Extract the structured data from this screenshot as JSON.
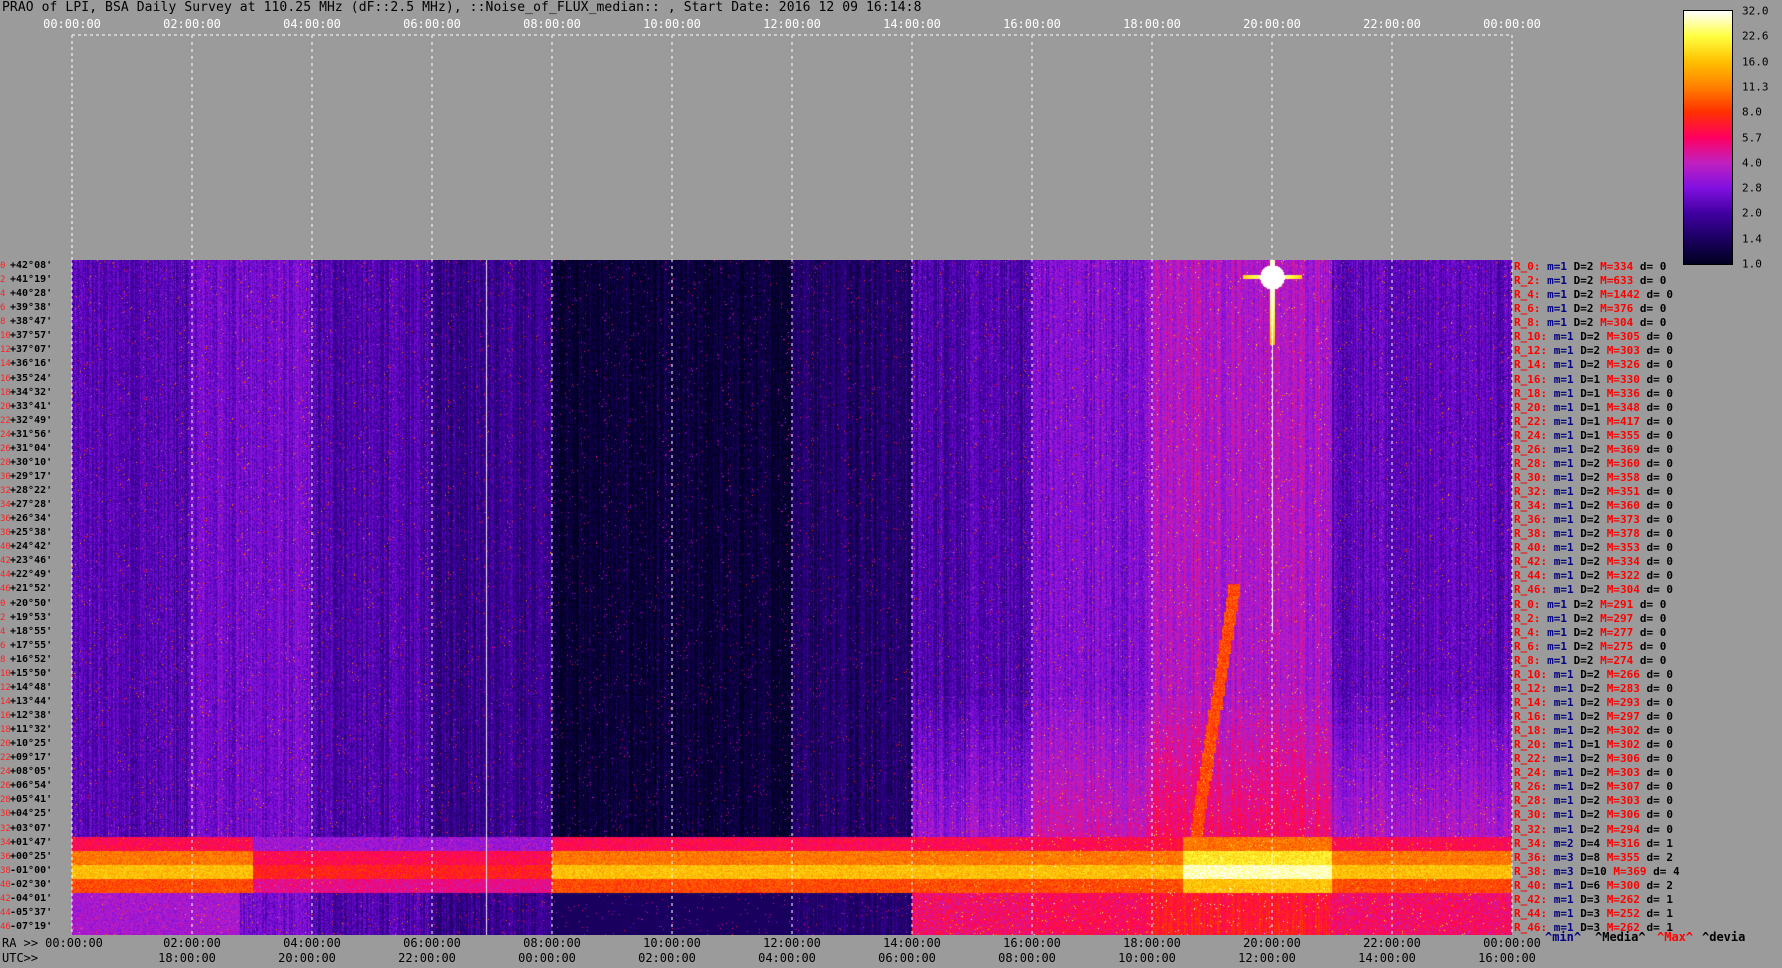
{
  "title": "PRAO of LPI, BSA Daily Survey at 110.25 MHz (dF::2.5 MHz), ::Noise_of_FLUX_median:: , Start Date: 2016 12 09 16:14:8",
  "top_axis_ticks": [
    "00:00:00",
    "02:00:00",
    "04:00:00",
    "06:00:00",
    "08:00:00",
    "10:00:00",
    "12:00:00",
    "14:00:00",
    "16:00:00",
    "18:00:00",
    "20:00:00",
    "22:00:00",
    "00:00:00"
  ],
  "bottom_axis": {
    "ra_label": "RA >>",
    "utc_label": "UTC>>",
    "ra_ticks": [
      "00:00:00",
      "02:00:00",
      "04:00:00",
      "06:00:00",
      "08:00:00",
      "10:00:00",
      "12:00:00",
      "14:00:00",
      "16:00:00",
      "18:00:00",
      "20:00:00",
      "22:00:00",
      "00:00:00"
    ],
    "utc_ticks": [
      "18:00:00",
      "20:00:00",
      "22:00:00",
      "00:00:00",
      "02:00:00",
      "04:00:00",
      "06:00:00",
      "08:00:00",
      "10:00:00",
      "12:00:00",
      "14:00:00",
      "16:00:00"
    ]
  },
  "declinations": [
    "+42°08'",
    "+41°19'",
    "+40°28'",
    "+39°38'",
    "+38°47'",
    "+37°57'",
    "+37°07'",
    "+36°16'",
    "+35°24'",
    "+34°32'",
    "+33°41'",
    "+32°49'",
    "+31°56'",
    "+31°04'",
    "+30°10'",
    "+29°17'",
    "+28°22'",
    "+27°28'",
    "+26°34'",
    "+25°38'",
    "+24°42'",
    "+23°46'",
    "+22°49'",
    "+21°52'",
    "+20°50'",
    "+19°53'",
    "+18°55'",
    "+17°55'",
    "+16°52'",
    "+15°50'",
    "+14°48'",
    "+13°44'",
    "+12°38'",
    "+11°32'",
    "+10°25'",
    "+09°17'",
    "+08°05'",
    "+06°54'",
    "+05°41'",
    "+04°25'",
    "+03°07'",
    "+01°47'",
    "+00°25'",
    "-01°00'",
    "-02°30'",
    "-04°01'",
    "-05°37'",
    "-07°19'"
  ],
  "row_numbers": [
    "0",
    "2",
    "4",
    "6",
    "8",
    "10",
    "12",
    "14",
    "16",
    "18",
    "20",
    "22",
    "24",
    "26",
    "28",
    "30",
    "32",
    "34",
    "36",
    "38",
    "40",
    "42",
    "44",
    "46",
    "0",
    "2",
    "4",
    "6",
    "8",
    "10",
    "12",
    "14",
    "16",
    "18",
    "20",
    "22",
    "24",
    "26",
    "28",
    "30",
    "32",
    "34",
    "36",
    "38",
    "40",
    "42",
    "44",
    "46"
  ],
  "row_stats": [
    {
      "r": "R_0:",
      "m": "m=1",
      "D": "D=2",
      "M": "M=334",
      "d": "d= 0"
    },
    {
      "r": "R_2:",
      "m": "m=1",
      "D": "D=2",
      "M": "M=633",
      "d": "d= 0"
    },
    {
      "r": "R_4:",
      "m": "m=1",
      "D": "D=2",
      "M": "M=1442",
      "d": "d= 0"
    },
    {
      "r": "R_6:",
      "m": "m=1",
      "D": "D=2",
      "M": "M=376",
      "d": "d= 0"
    },
    {
      "r": "R_8:",
      "m": "m=1",
      "D": "D=2",
      "M": "M=304",
      "d": "d= 0"
    },
    {
      "r": "R_10:",
      "m": "m=1",
      "D": "D=2",
      "M": "M=305",
      "d": "d= 0"
    },
    {
      "r": "R_12:",
      "m": "m=1",
      "D": "D=2",
      "M": "M=303",
      "d": "d= 0"
    },
    {
      "r": "R_14:",
      "m": "m=1",
      "D": "D=2",
      "M": "M=326",
      "d": "d= 0"
    },
    {
      "r": "R_16:",
      "m": "m=1",
      "D": "D=1",
      "M": "M=330",
      "d": "d= 0"
    },
    {
      "r": "R_18:",
      "m": "m=1",
      "D": "D=1",
      "M": "M=336",
      "d": "d= 0"
    },
    {
      "r": "R_20:",
      "m": "m=1",
      "D": "D=1",
      "M": "M=348",
      "d": "d= 0"
    },
    {
      "r": "R_22:",
      "m": "m=1",
      "D": "D=1",
      "M": "M=417",
      "d": "d= 0"
    },
    {
      "r": "R_24:",
      "m": "m=1",
      "D": "D=1",
      "M": "M=355",
      "d": "d= 0"
    },
    {
      "r": "R_26:",
      "m": "m=1",
      "D": "D=2",
      "M": "M=369",
      "d": "d= 0"
    },
    {
      "r": "R_28:",
      "m": "m=1",
      "D": "D=2",
      "M": "M=360",
      "d": "d= 0"
    },
    {
      "r": "R_30:",
      "m": "m=1",
      "D": "D=2",
      "M": "M=358",
      "d": "d= 0"
    },
    {
      "r": "R_32:",
      "m": "m=1",
      "D": "D=2",
      "M": "M=351",
      "d": "d= 0"
    },
    {
      "r": "R_34:",
      "m": "m=1",
      "D": "D=2",
      "M": "M=360",
      "d": "d= 0"
    },
    {
      "r": "R_36:",
      "m": "m=1",
      "D": "D=2",
      "M": "M=373",
      "d": "d= 0"
    },
    {
      "r": "R_38:",
      "m": "m=1",
      "D": "D=2",
      "M": "M=378",
      "d": "d= 0"
    },
    {
      "r": "R_40:",
      "m": "m=1",
      "D": "D=2",
      "M": "M=353",
      "d": "d= 0"
    },
    {
      "r": "R_42:",
      "m": "m=1",
      "D": "D=2",
      "M": "M=334",
      "d": "d= 0"
    },
    {
      "r": "R_44:",
      "m": "m=1",
      "D": "D=2",
      "M": "M=322",
      "d": "d= 0"
    },
    {
      "r": "R_46:",
      "m": "m=1",
      "D": "D=2",
      "M": "M=304",
      "d": "d= 0"
    },
    {
      "r": "R_0:",
      "m": "m=1",
      "D": "D=2",
      "M": "M=291",
      "d": "d= 0"
    },
    {
      "r": "R_2:",
      "m": "m=1",
      "D": "D=2",
      "M": "M=297",
      "d": "d= 0"
    },
    {
      "r": "R_4:",
      "m": "m=1",
      "D": "D=2",
      "M": "M=277",
      "d": "d= 0"
    },
    {
      "r": "R_6:",
      "m": "m=1",
      "D": "D=2",
      "M": "M=275",
      "d": "d= 0"
    },
    {
      "r": "R_8:",
      "m": "m=1",
      "D": "D=2",
      "M": "M=274",
      "d": "d= 0"
    },
    {
      "r": "R_10:",
      "m": "m=1",
      "D": "D=2",
      "M": "M=266",
      "d": "d= 0"
    },
    {
      "r": "R_12:",
      "m": "m=1",
      "D": "D=2",
      "M": "M=283",
      "d": "d= 0"
    },
    {
      "r": "R_14:",
      "m": "m=1",
      "D": "D=2",
      "M": "M=293",
      "d": "d= 0"
    },
    {
      "r": "R_16:",
      "m": "m=1",
      "D": "D=2",
      "M": "M=297",
      "d": "d= 0"
    },
    {
      "r": "R_18:",
      "m": "m=1",
      "D": "D=2",
      "M": "M=302",
      "d": "d= 0"
    },
    {
      "r": "R_20:",
      "m": "m=1",
      "D": "D=1",
      "M": "M=302",
      "d": "d= 0"
    },
    {
      "r": "R_22:",
      "m": "m=1",
      "D": "D=2",
      "M": "M=306",
      "d": "d= 0"
    },
    {
      "r": "R_24:",
      "m": "m=1",
      "D": "D=2",
      "M": "M=303",
      "d": "d= 0"
    },
    {
      "r": "R_26:",
      "m": "m=1",
      "D": "D=2",
      "M": "M=307",
      "d": "d= 0"
    },
    {
      "r": "R_28:",
      "m": "m=1",
      "D": "D=2",
      "M": "M=303",
      "d": "d= 0"
    },
    {
      "r": "R_30:",
      "m": "m=1",
      "D": "D=2",
      "M": "M=306",
      "d": "d= 0"
    },
    {
      "r": "R_32:",
      "m": "m=1",
      "D": "D=2",
      "M": "M=294",
      "d": "d= 0"
    },
    {
      "r": "R_34:",
      "m": "m=2",
      "D": "D=4",
      "M": "M=316",
      "d": "d= 1"
    },
    {
      "r": "R_36:",
      "m": "m=3",
      "D": "D=8",
      "M": "M=355",
      "d": "d= 2"
    },
    {
      "r": "R_38:",
      "m": "m=3",
      "D": "D=10",
      "M": "M=369",
      "d": "d= 4"
    },
    {
      "r": "R_40:",
      "m": "m=1",
      "D": "D=6",
      "M": "M=300",
      "d": "d= 2"
    },
    {
      "r": "R_42:",
      "m": "m=1",
      "D": "D=3",
      "M": "M=262",
      "d": "d= 1"
    },
    {
      "r": "R_44:",
      "m": "m=1",
      "D": "D=3",
      "M": "M=252",
      "d": "d= 1"
    },
    {
      "r": "R_46:",
      "m": "m=1",
      "D": "D=3",
      "M": "M=262",
      "d": "d= 1"
    }
  ],
  "stats_legend": {
    "min": "^min^",
    "median": "^Media^",
    "max": "^Max^",
    "devia": "^devia"
  },
  "colorbar": {
    "ticks": [
      "32.0",
      "22.6",
      "16.0",
      "11.3",
      "8.0",
      "5.7",
      "4.0",
      "2.8",
      "2.0",
      "1.4",
      "1.0"
    ],
    "scale": "log",
    "colors": [
      "#000020",
      "#1a0060",
      "#4000a0",
      "#8010e0",
      "#c020c0",
      "#ff0060",
      "#ff3000",
      "#ff8000",
      "#ffc000",
      "#ffff40",
      "#ffffff"
    ]
  },
  "chart_data": {
    "type": "heatmap",
    "title": "PRAO of LPI, BSA Daily Survey at 110.25 MHz (dF::2.5 MHz), ::Noise_of_FLUX_median:: , Start Date: 2016 12 09 16:14:8",
    "x_axis": "RA 00:00:00 to 24:00:00 (top/bottom), UTC 16:14 to 16:14 next day",
    "y_axis": "Declination rows +42°08' to -07°19' (48 beams)",
    "value_range": [
      1.0,
      32.0
    ],
    "features": [
      {
        "region": "rows +00°25' to -02°30'",
        "ra_range": [
          "00:00",
          "24:00"
        ],
        "level": "8-32 (bright band)"
      },
      {
        "region": "rows +42°08' to +36°16'",
        "ra_center": "20:00",
        "level": "32 (point source)"
      },
      {
        "region": "all rows",
        "ra_range": [
          "08:00",
          "12:00"
        ],
        "level": "1.0-1.4 (darkest)"
      },
      {
        "region": "rows +41°19' to +20°50'",
        "ra_range": [
          "02:00",
          "04:00"
        ],
        "level": "4-8 (speckled)"
      },
      {
        "region": "rows +10°25' to +04°25'",
        "ra_range": [
          "18:00",
          "20:00"
        ],
        "level": "5.7-11.3 (diagonal ridge)"
      }
    ]
  }
}
